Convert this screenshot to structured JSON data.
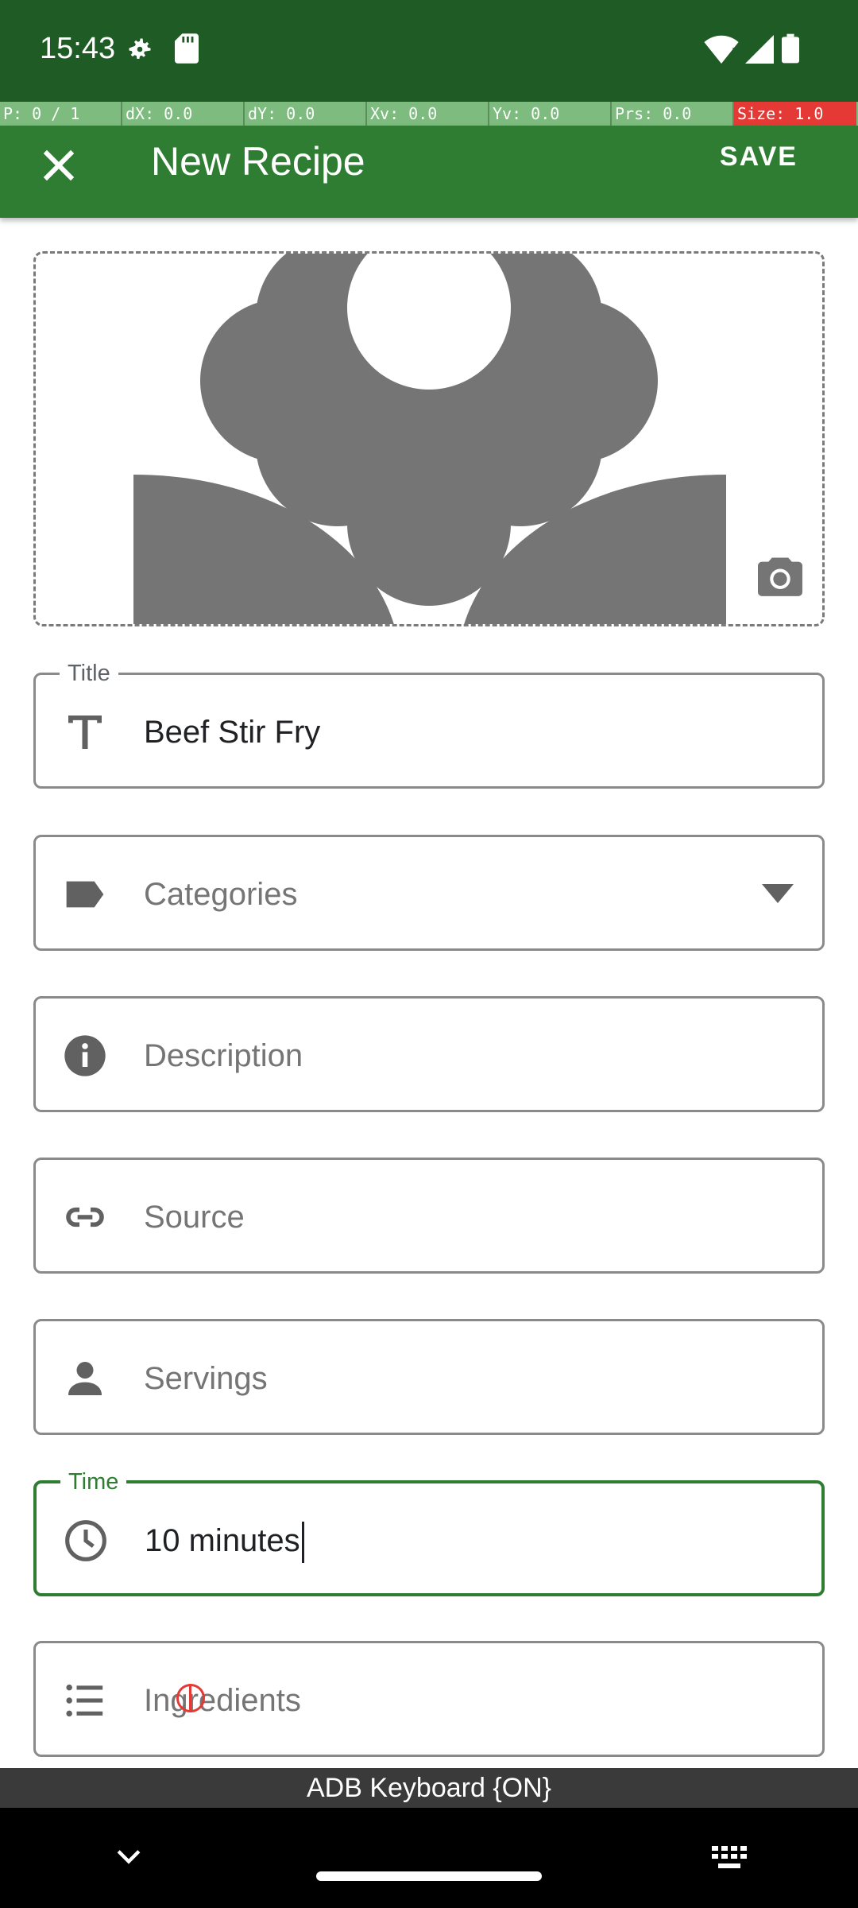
{
  "status_bar": {
    "time": "15:43",
    "icons": [
      "gear-icon",
      "sd-card-icon",
      "wifi-icon",
      "signal-icon",
      "battery-icon"
    ]
  },
  "debug_overlay": [
    "P: 0 / 1",
    "dX: 0.0",
    "dY: 0.0",
    "Xv: 0.0",
    "Yv: 0.0",
    "Prs: 0.0",
    "Size: 1.0"
  ],
  "app_bar": {
    "title": "New Recipe",
    "save_label": "SAVE",
    "close_icon": "close-icon"
  },
  "image_picker": {
    "placeholder_icon": "flower-image-icon",
    "action_icon": "camera-icon"
  },
  "form": {
    "title": {
      "label": "Title",
      "value": "Beef Stir Fry",
      "icon": "text-icon"
    },
    "categories": {
      "placeholder": "Categories",
      "icon": "label-icon"
    },
    "description": {
      "placeholder": "Description",
      "icon": "info-icon"
    },
    "source": {
      "placeholder": "Source",
      "icon": "link-icon"
    },
    "servings": {
      "placeholder": "Servings",
      "icon": "person-icon"
    },
    "time": {
      "label": "Time",
      "value": "10 minutes",
      "icon": "clock-icon"
    },
    "ingredients": {
      "placeholder": "Ingredients",
      "icon": "list-icon"
    }
  },
  "keyboard_banner": "ADB Keyboard {ON}",
  "colors": {
    "status_bar": "#1f5b24",
    "app_bar": "#2e7d32",
    "accent": "#2e7d32",
    "debug_bar": "#7dbb7f",
    "debug_alert": "#e53935"
  }
}
